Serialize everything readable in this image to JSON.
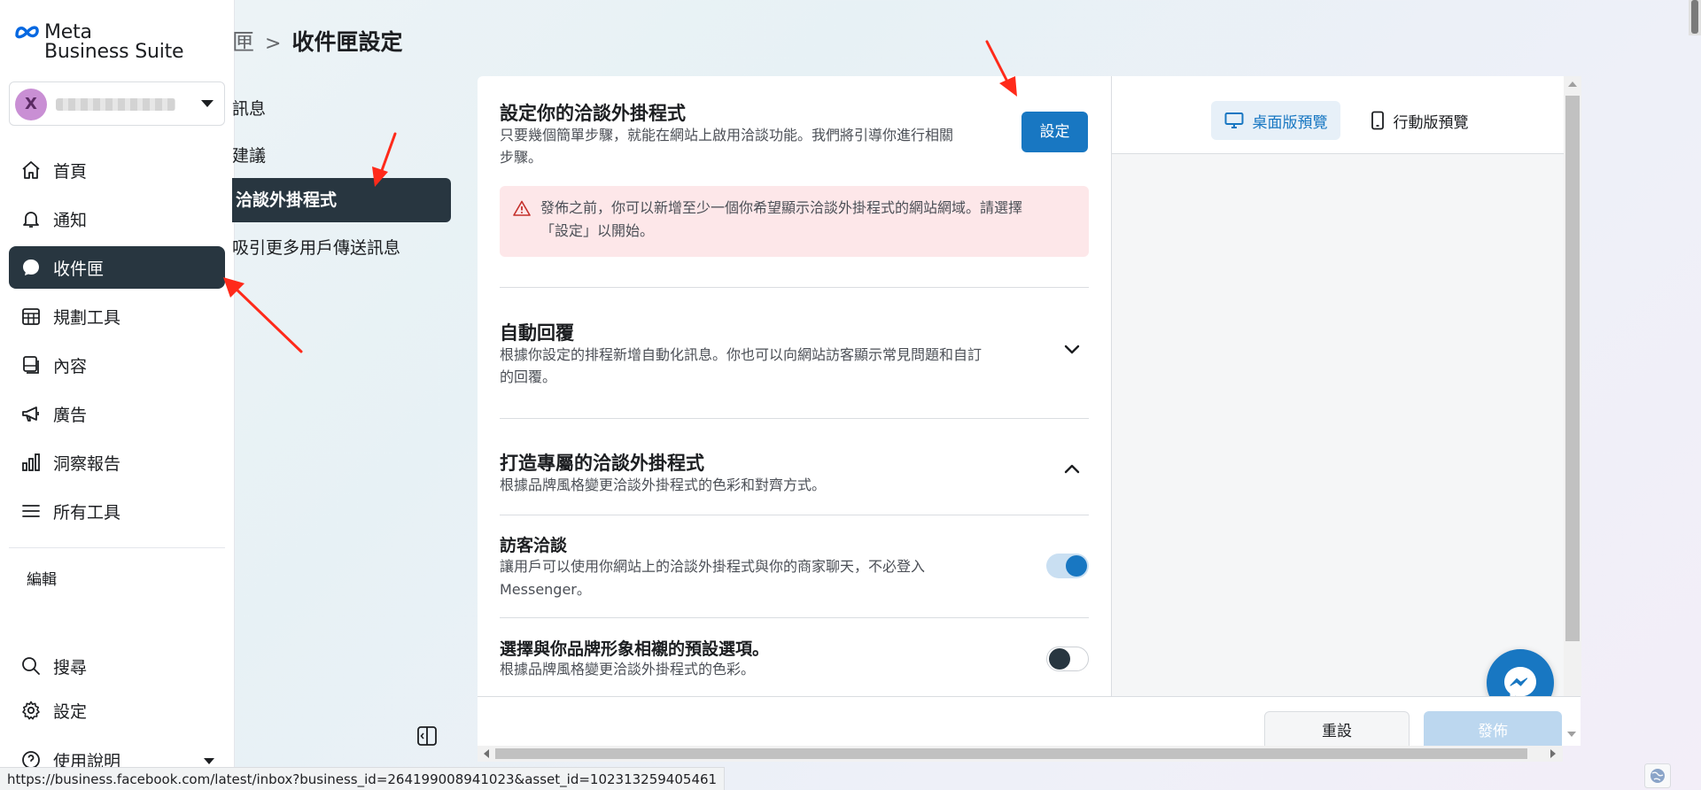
{
  "brand": {
    "meta": "Meta",
    "suite": "Business Suite"
  },
  "account": {
    "initial": "X"
  },
  "nav": {
    "items": [
      {
        "label": "首頁",
        "icon": "home-icon"
      },
      {
        "label": "通知",
        "icon": "bell-icon"
      },
      {
        "label": "收件匣",
        "icon": "chat-bubble-icon"
      },
      {
        "label": "規劃工具",
        "icon": "calendar-grid-icon"
      },
      {
        "label": "內容",
        "icon": "content-icon"
      },
      {
        "label": "廣告",
        "icon": "megaphone-icon"
      },
      {
        "label": "洞察報告",
        "icon": "bar-chart-icon"
      },
      {
        "label": "所有工具",
        "icon": "menu-icon"
      }
    ],
    "edit": "編輯",
    "bottom": [
      {
        "label": "搜尋",
        "icon": "search-icon"
      },
      {
        "label": "設定",
        "icon": "gear-icon"
      },
      {
        "label": "使用說明",
        "icon": "help-icon"
      }
    ]
  },
  "breadcrumb": {
    "parent": "匣",
    "separator": ">",
    "current": "收件匣設定"
  },
  "subnav": {
    "items": [
      "訊息",
      "建議",
      "洽談外掛程式",
      "吸引更多用戶傳送訊息"
    ]
  },
  "setup": {
    "title": "設定你的洽談外掛程式",
    "desc_line1": "只要幾個簡單步驟，就能在網站上啟用洽談功能。我們將引導你進行相關",
    "desc_line2": "步驟。",
    "button": "設定",
    "warning_line1": "發佈之前，你可以新增至少一個你希望顯示洽談外掛程式的網站網域。請選擇",
    "warning_line2": "「設定」以開始。"
  },
  "auto_reply": {
    "title": "自動回覆",
    "desc_line1": "根據你設定的排程新增自動化訊息。你也可以向網站訪客顯示常見問題和自訂",
    "desc_line2": "的回覆。"
  },
  "customize": {
    "title": "打造專屬的洽談外掛程式",
    "desc": "根據品牌風格變更洽談外掛程式的色彩和對齊方式。"
  },
  "guest_chat": {
    "title": "訪客洽談",
    "desc_line1": "讓用戶可以使用你網站上的洽談外掛程式與你的商家聊天，不必登入",
    "desc_line2": "Messenger。",
    "enabled": true
  },
  "brand_preset": {
    "title": "選擇與你品牌形象相襯的預設選項。",
    "desc": "根據品牌風格變更洽談外掛程式的色彩。",
    "enabled": false
  },
  "preview": {
    "desktop_tab": "桌面版預覽",
    "mobile_tab": "行動版預覽"
  },
  "footer": {
    "reset": "重設",
    "publish": "發佈"
  },
  "statusbar": {
    "url": "https://business.facebook.com/latest/inbox?business_id=264199008941023&asset_id=102313259405461"
  },
  "colors": {
    "accent": "#1877c2",
    "nav_active": "#283640",
    "warning_bg": "#fde7e9",
    "annotation": "#ff2a1a"
  }
}
